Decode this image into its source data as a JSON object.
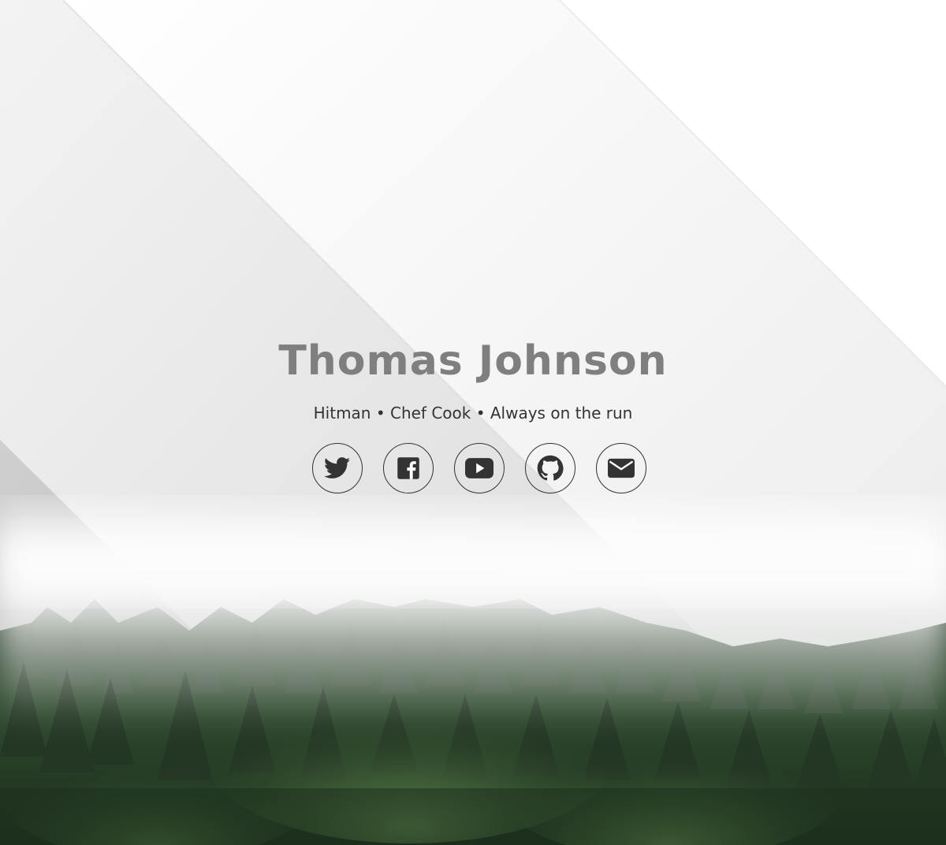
{
  "profile": {
    "name": "Thomas Johnson",
    "tagline": "Hitman • Chef Cook • Always on the run"
  },
  "socials": [
    {
      "name": "twitter",
      "icon": "twitter-icon"
    },
    {
      "name": "facebook",
      "icon": "facebook-icon"
    },
    {
      "name": "youtube",
      "icon": "youtube-icon"
    },
    {
      "name": "github",
      "icon": "github-icon"
    },
    {
      "name": "email",
      "icon": "envelope-icon"
    }
  ],
  "colors": {
    "name_text": "#7f7f7f",
    "tagline_text": "#333333",
    "icon": "#333333",
    "forest_dark": "#1f2e1f",
    "forest_light": "#5f8a4f"
  }
}
